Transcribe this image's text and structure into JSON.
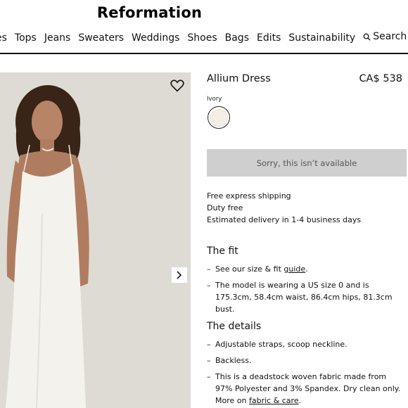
{
  "brand": "Reformation",
  "nav": {
    "items": [
      "es",
      "Tops",
      "Jeans",
      "Sweaters",
      "Weddings",
      "Shoes",
      "Bags",
      "Edits",
      "Sustainability"
    ],
    "search_label": "Search"
  },
  "product": {
    "name": "Allium Dress",
    "price": "CA$ 538",
    "color_label": "Ivory",
    "swatch_color": "#f3efe6",
    "unavailable_label": "Sorry, this isn’t available",
    "shipping": [
      "Free express shipping",
      "Duty free",
      "Estimated delivery in 1-4 business days"
    ]
  },
  "fit": {
    "heading": "The fit",
    "item1_prefix": "See our size & fit ",
    "item1_link": "guide",
    "item1_suffix": ".",
    "item2": "The model is wearing a US size 0 and is 175.3cm, 58.4cm waist, 86.4cm hips, 81.3cm bust."
  },
  "details": {
    "heading": "The details",
    "item1": "Adjustable straps, scoop neckline.",
    "item2": "Backless.",
    "item3_prefix": "This is a deadstock woven fabric made from 97% Polyester and 3% Spandex. Dry clean only. More on ",
    "item3_link": "fabric & care",
    "item3_suffix": "."
  },
  "icons": {
    "search": "search-icon",
    "wishlist": "heart-icon",
    "next": "chevron-right-icon"
  }
}
